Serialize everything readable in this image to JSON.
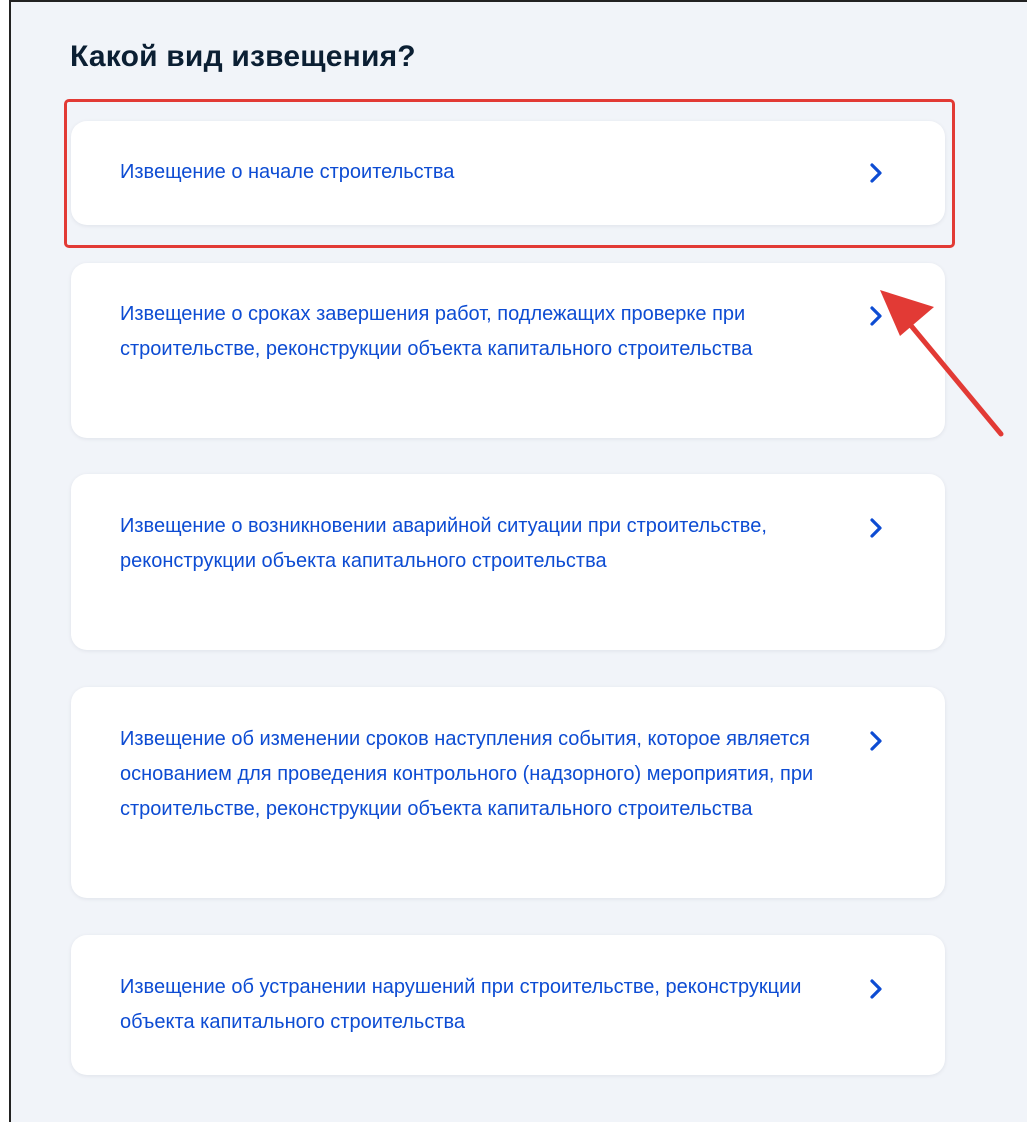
{
  "heading": "Какой вид извещения?",
  "options": [
    {
      "label": "Извещение о начале строительства",
      "icon": "chevron-right-icon",
      "highlighted": true
    },
    {
      "label": "Извещение о сроках завершения работ, подлежащих проверке при строительстве, реконструкции объекта капитального строительства",
      "icon": "chevron-right-icon"
    },
    {
      "label": "Извещение о возникновении аварийной ситуации при строительстве, реконструкции объекта капитального строительства",
      "icon": "chevron-right-icon"
    },
    {
      "label": "Извещение об изменении сроков наступления события, которое является основанием для проведения контрольного (надзорного) мероприятия, при строительстве, реконструкции объекта капитального строительства",
      "icon": "chevron-right-icon"
    },
    {
      "label": "Извещение об устранении нарушений при строительстве, реконструкции объекта капитального строительства",
      "icon": "chevron-right-icon"
    }
  ],
  "colors": {
    "link": "#0d4cd3",
    "heading": "#0b1f33",
    "background": "#f1f4f9",
    "annotation": "#e23a35"
  }
}
